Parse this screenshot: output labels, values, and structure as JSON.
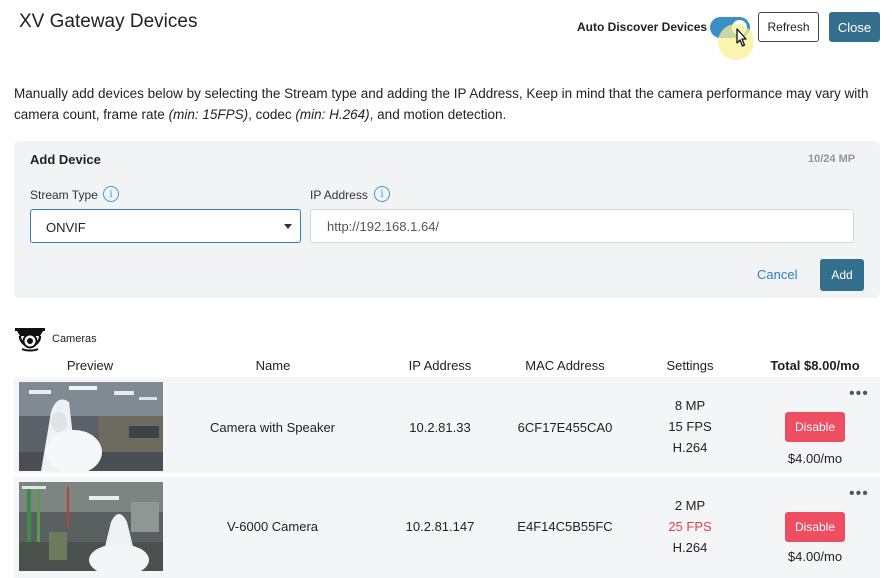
{
  "header": {
    "title": "XV Gateway Devices",
    "auto_discover_label": "Auto Discover Devices",
    "auto_discover_on": true,
    "refresh_label": "Refresh",
    "close_label": "Close"
  },
  "description": {
    "part1": "Manually add devices below by selecting the Stream type and adding the IP Address, Keep in mind that the camera performance may vary with camera count, frame rate ",
    "fps_hint": "(min: 15FPS)",
    "part2": ", codec ",
    "codec_hint": "(min: H.264)",
    "part3": ", and motion detection."
  },
  "add_device": {
    "title": "Add Device",
    "mp_usage": "10/24 MP",
    "stream_type_label": "Stream Type",
    "stream_type_value": "ONVIF",
    "ip_label": "IP Address",
    "ip_placeholder": "http://192.168.1.64/",
    "cancel_label": "Cancel",
    "add_label": "Add"
  },
  "cameras": {
    "section_label": "Cameras",
    "columns": {
      "preview": "Preview",
      "name": "Name",
      "ip": "IP Address",
      "mac": "MAC Address",
      "settings": "Settings",
      "total": "Total $8.00/mo"
    },
    "rows": [
      {
        "name": "Camera with Speaker",
        "ip": "10.2.81.33",
        "mac": "6CF17E455CA0",
        "mp": "8 MP",
        "fps": "15 FPS",
        "codec": "H.264",
        "fps_warning": false,
        "disable_label": "Disable",
        "price": "$4.00/mo",
        "more": "•••"
      },
      {
        "name": "V-6000 Camera",
        "ip": "10.2.81.147",
        "mac": "E4F14C5B55FC",
        "mp": "2 MP",
        "fps": "25 FPS",
        "codec": "H.264",
        "fps_warning": true,
        "disable_label": "Disable",
        "price": "$4.00/mo",
        "more": "•••"
      }
    ]
  },
  "colors": {
    "primary": "#356f8e",
    "toggle": "#3a8fc7",
    "danger": "#ef4d62",
    "warning_text": "#e0414f",
    "panel_bg": "#f2f3f5",
    "info": "#3a9bd5"
  }
}
